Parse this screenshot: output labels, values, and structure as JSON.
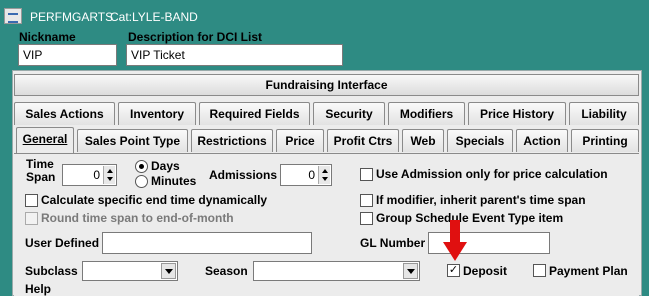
{
  "window": {
    "app": "PERFMGARTS",
    "category": "Cat:LYLE-BAND"
  },
  "header": {
    "nickname_label": "Nickname",
    "nickname_value": "VIP",
    "description_label": "Description for DCI List",
    "description_value": "VIP Ticket"
  },
  "fundraising_button": "Fundraising Interface",
  "tabs_row1": [
    "Sales Actions",
    "Inventory",
    "Required Fields",
    "Security",
    "Modifiers",
    "Price History",
    "Liability"
  ],
  "tabs_row2": [
    "General",
    "Sales Point Type",
    "Restrictions",
    "Price",
    "Profit Ctrs",
    "Web",
    "Specials",
    "Action",
    "Printing"
  ],
  "active_tab": "General",
  "general": {
    "time_span_label": "Time Span",
    "time_span_value": "0",
    "unit_days": "Days",
    "unit_minutes": "Minutes",
    "unit_selected": "Days",
    "admissions_label": "Admissions",
    "admissions_value": "0",
    "use_admission_label": "Use Admission only for price calculation",
    "use_admission_checked": false,
    "calc_end_time_label": "Calculate specific end time dynamically",
    "calc_end_time_checked": false,
    "inherit_time_span_label": "If modifier, inherit parent's time span",
    "inherit_time_span_checked": false,
    "round_time_span_label": "Round time span to end-of-month",
    "round_time_span_enabled": false,
    "group_schedule_label": "Group Schedule Event Type item",
    "group_schedule_checked": false,
    "user_defined_label": "User Defined",
    "user_defined_value": "",
    "gl_number_label": "GL Number",
    "gl_number_value": "",
    "subclass_label": "Subclass",
    "subclass_value": "",
    "season_label": "Season",
    "season_value": "",
    "deposit_label": "Deposit",
    "deposit_checked": true,
    "deposit_check_mark": "✓",
    "payment_plan_label": "Payment Plan",
    "payment_plan_checked": false,
    "help_label": "Help"
  },
  "colors": {
    "background": "#2e8b83",
    "annotation_arrow": "#e01010"
  }
}
